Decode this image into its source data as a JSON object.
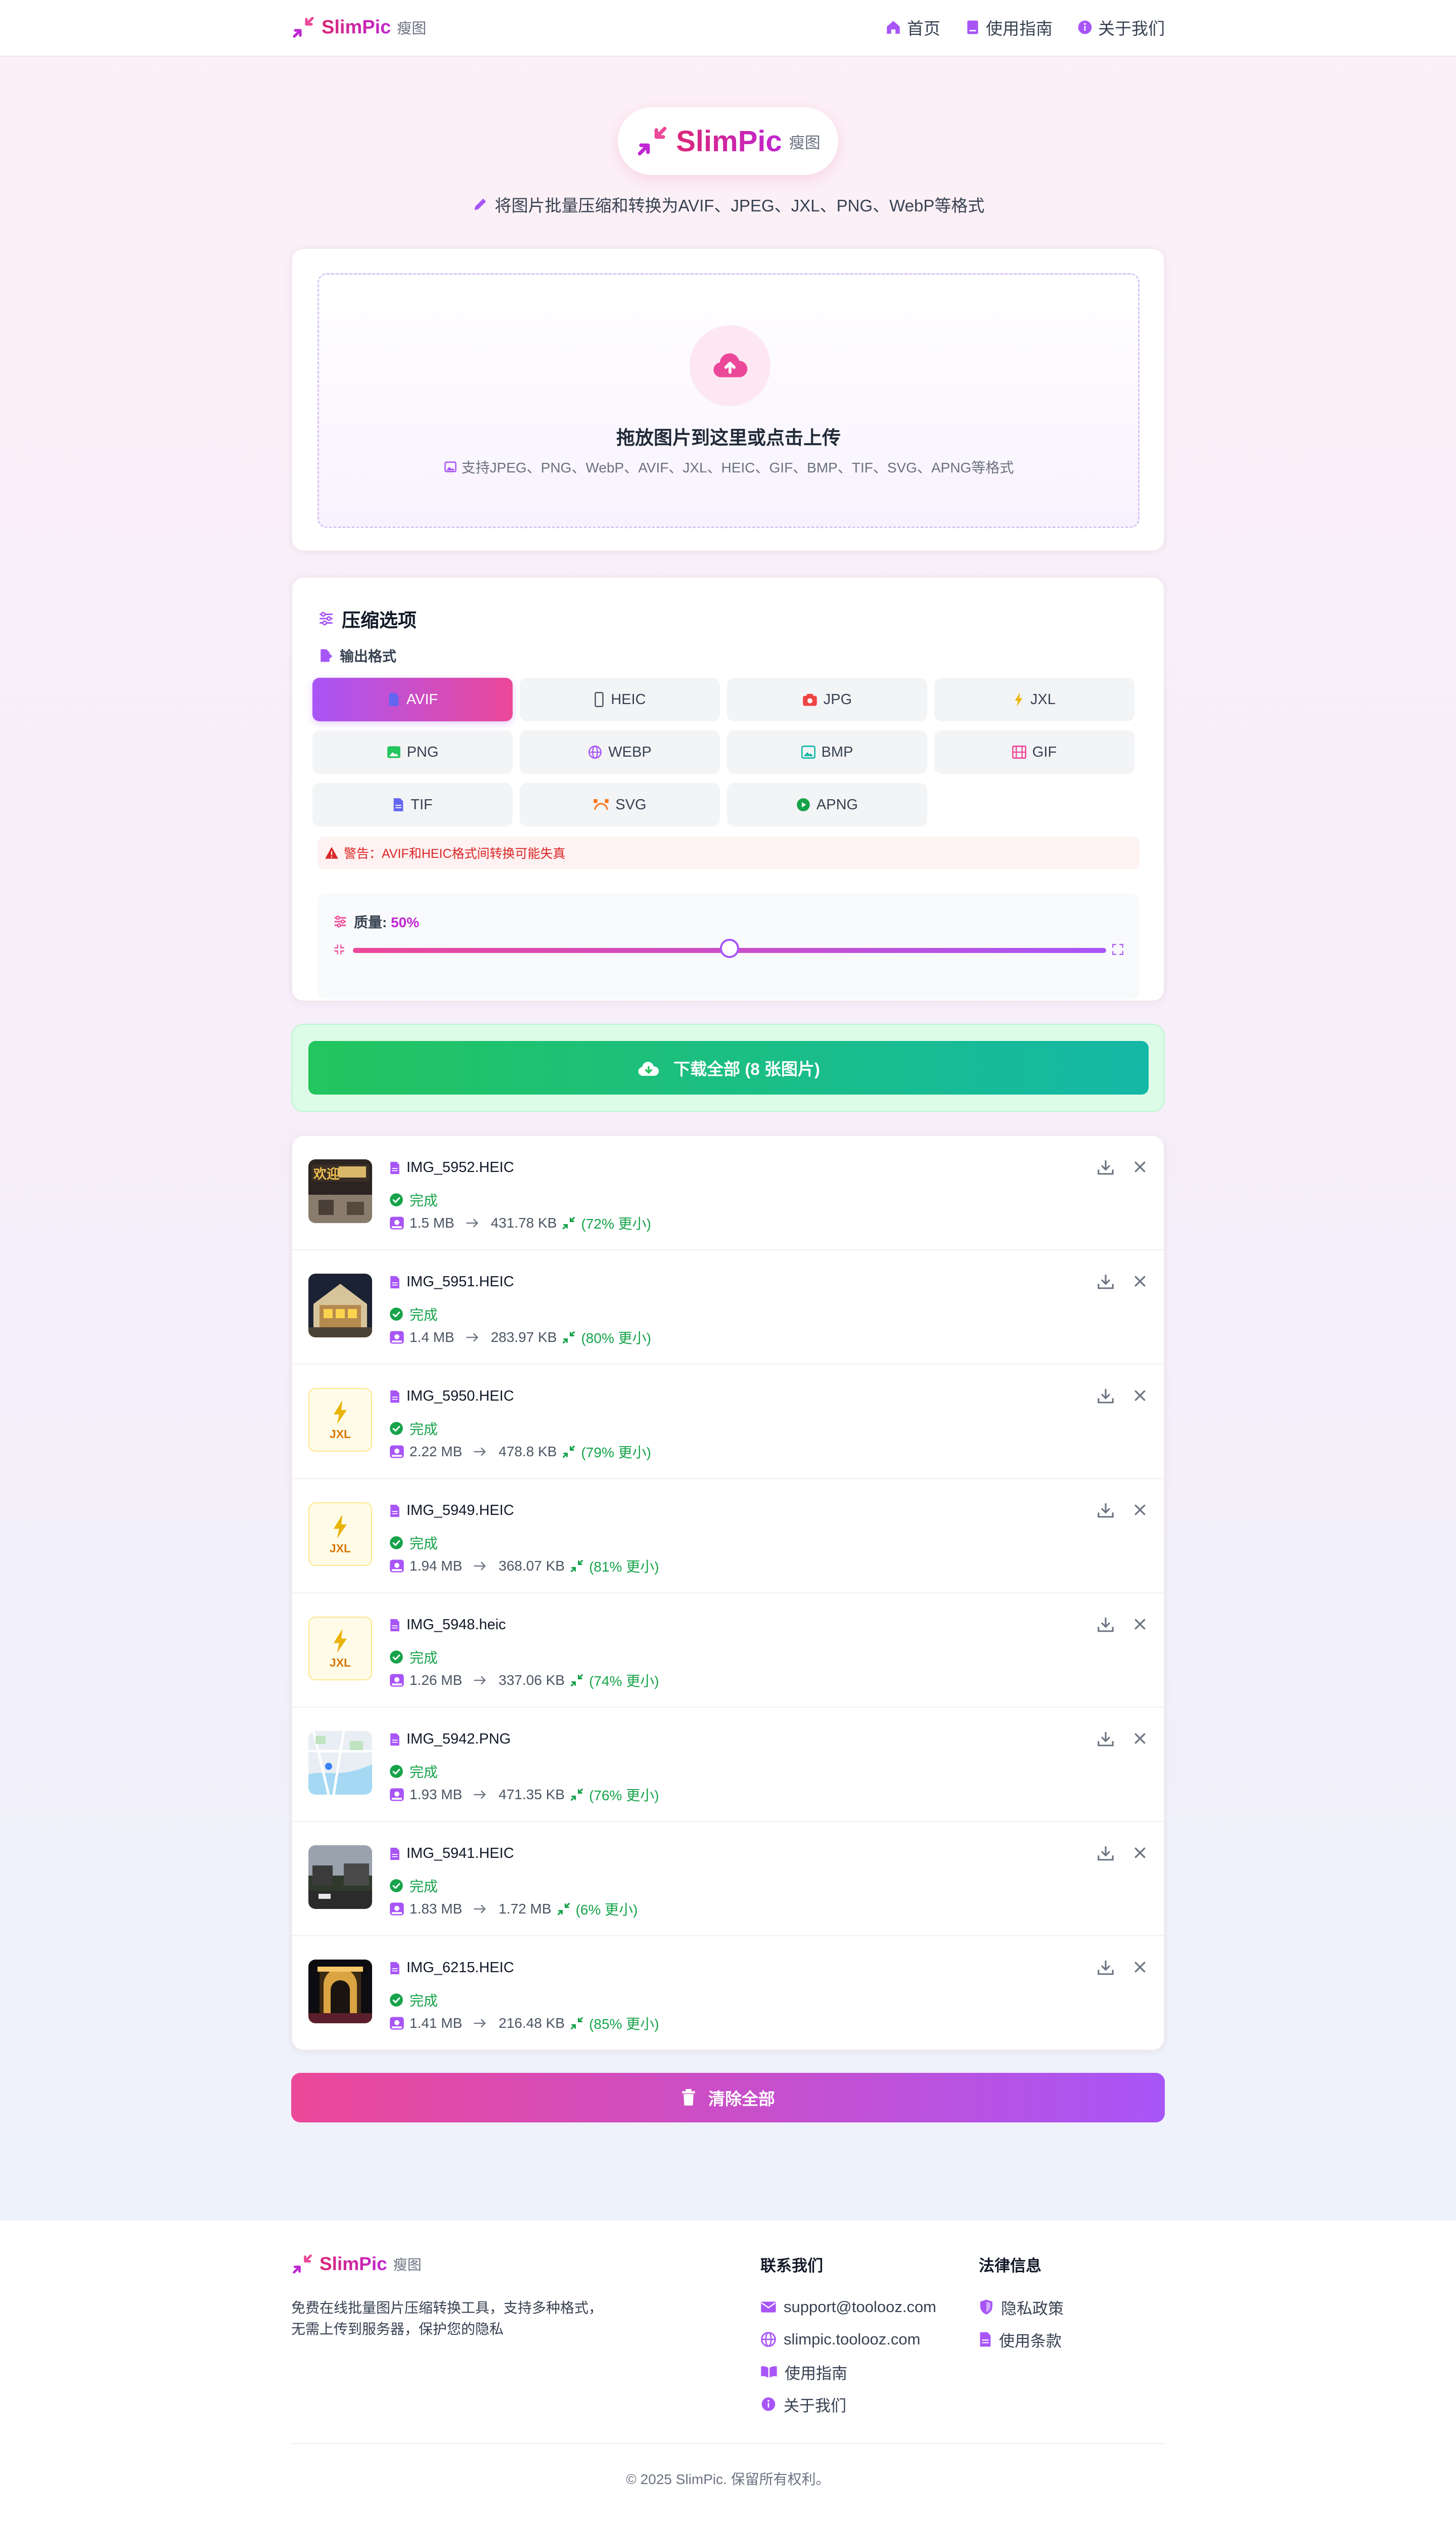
{
  "header": {
    "brand": "SlimPic",
    "brand_sub": "瘦图",
    "nav": [
      {
        "label": "首页",
        "icon": "home-icon"
      },
      {
        "label": "使用指南",
        "icon": "book-icon"
      },
      {
        "label": "关于我们",
        "icon": "info-icon"
      }
    ]
  },
  "hero": {
    "brand": "SlimPic",
    "brand_sub": "瘦图",
    "tagline": "将图片批量压缩和转换为AVIF、JPEG、JXL、PNG、WebP等格式"
  },
  "upload": {
    "title": "拖放图片到这里或点击上传",
    "subtitle": "支持JPEG、PNG、WebP、AVIF、JXL、HEIC、GIF、BMP、TIF、SVG、APNG等格式"
  },
  "options": {
    "title": "压缩选项",
    "format_label": "输出格式",
    "formats": [
      {
        "label": "AVIF",
        "icon": "file-icon",
        "active": true
      },
      {
        "label": "HEIC",
        "icon": "phone-icon",
        "active": false
      },
      {
        "label": "JPG",
        "icon": "camera-icon",
        "active": false
      },
      {
        "label": "JXL",
        "icon": "bolt-icon",
        "active": false
      },
      {
        "label": "PNG",
        "icon": "image-icon",
        "active": false
      },
      {
        "label": "WEBP",
        "icon": "globe-icon",
        "active": false
      },
      {
        "label": "BMP",
        "icon": "picture-icon",
        "active": false
      },
      {
        "label": "GIF",
        "icon": "film-icon",
        "active": false
      },
      {
        "label": "TIF",
        "icon": "document-icon",
        "active": false
      },
      {
        "label": "SVG",
        "icon": "bezier-icon",
        "active": false
      },
      {
        "label": "APNG",
        "icon": "play-icon",
        "active": false
      }
    ],
    "warning": "警告：AVIF和HEIC格式间转换可能失真",
    "quality_label": "质量: ",
    "quality_value": "50%",
    "quality_level": 0.5
  },
  "download_all": "下载全部 (8 张图片)",
  "files": [
    {
      "name": "IMG_5952.HEIC",
      "status": "完成",
      "orig": "1.5 MB",
      "comp": "431.78 KB",
      "saving": "(72% 更小)",
      "thumb": "photo-sign"
    },
    {
      "name": "IMG_5951.HEIC",
      "status": "完成",
      "orig": "1.4 MB",
      "comp": "283.97 KB",
      "saving": "(80% 更小)",
      "thumb": "photo-building"
    },
    {
      "name": "IMG_5950.HEIC",
      "status": "完成",
      "orig": "2.22 MB",
      "comp": "478.8 KB",
      "saving": "(79% 更小)",
      "thumb": "jxl",
      "thumb_label": "JXL"
    },
    {
      "name": "IMG_5949.HEIC",
      "status": "完成",
      "orig": "1.94 MB",
      "comp": "368.07 KB",
      "saving": "(81% 更小)",
      "thumb": "jxl",
      "thumb_label": "JXL"
    },
    {
      "name": "IMG_5948.heic",
      "status": "完成",
      "orig": "1.26 MB",
      "comp": "337.06 KB",
      "saving": "(74% 更小)",
      "thumb": "jxl",
      "thumb_label": "JXL"
    },
    {
      "name": "IMG_5942.PNG",
      "status": "完成",
      "orig": "1.93 MB",
      "comp": "471.35 KB",
      "saving": "(76% 更小)",
      "thumb": "map"
    },
    {
      "name": "IMG_5941.HEIC",
      "status": "完成",
      "orig": "1.83 MB",
      "comp": "1.72 MB",
      "saving": "(6% 更小)",
      "thumb": "photo-street"
    },
    {
      "name": "IMG_6215.HEIC",
      "status": "完成",
      "orig": "1.41 MB",
      "comp": "216.48 KB",
      "saving": "(85% 更小)",
      "thumb": "photo-night"
    }
  ],
  "clear_all": "清除全部",
  "footer": {
    "brand": "SlimPic",
    "brand_sub": "瘦图",
    "desc_line1": "免费在线批量图片压缩转换工具，支持多种格式，",
    "desc_line2": "无需上传到服务器，保护您的隐私",
    "contact_title": "联系我们",
    "contact": [
      {
        "label": "support@toolooz.com",
        "icon": "mail-icon"
      },
      {
        "label": "slimpic.toolooz.com",
        "icon": "globe-icon"
      },
      {
        "label": "使用指南",
        "icon": "book-icon"
      },
      {
        "label": "关于我们",
        "icon": "info-icon"
      }
    ],
    "legal_title": "法律信息",
    "legal": [
      {
        "label": "隐私政策",
        "icon": "shield-icon"
      },
      {
        "label": "使用条款",
        "icon": "document-icon"
      }
    ],
    "copyright": "© 2025 SlimPic. 保留所有权利。"
  },
  "colors": {
    "primary": "#ec4899",
    "secondary": "#a855f7",
    "success": "#22c55e",
    "warning": "#dc2626"
  }
}
